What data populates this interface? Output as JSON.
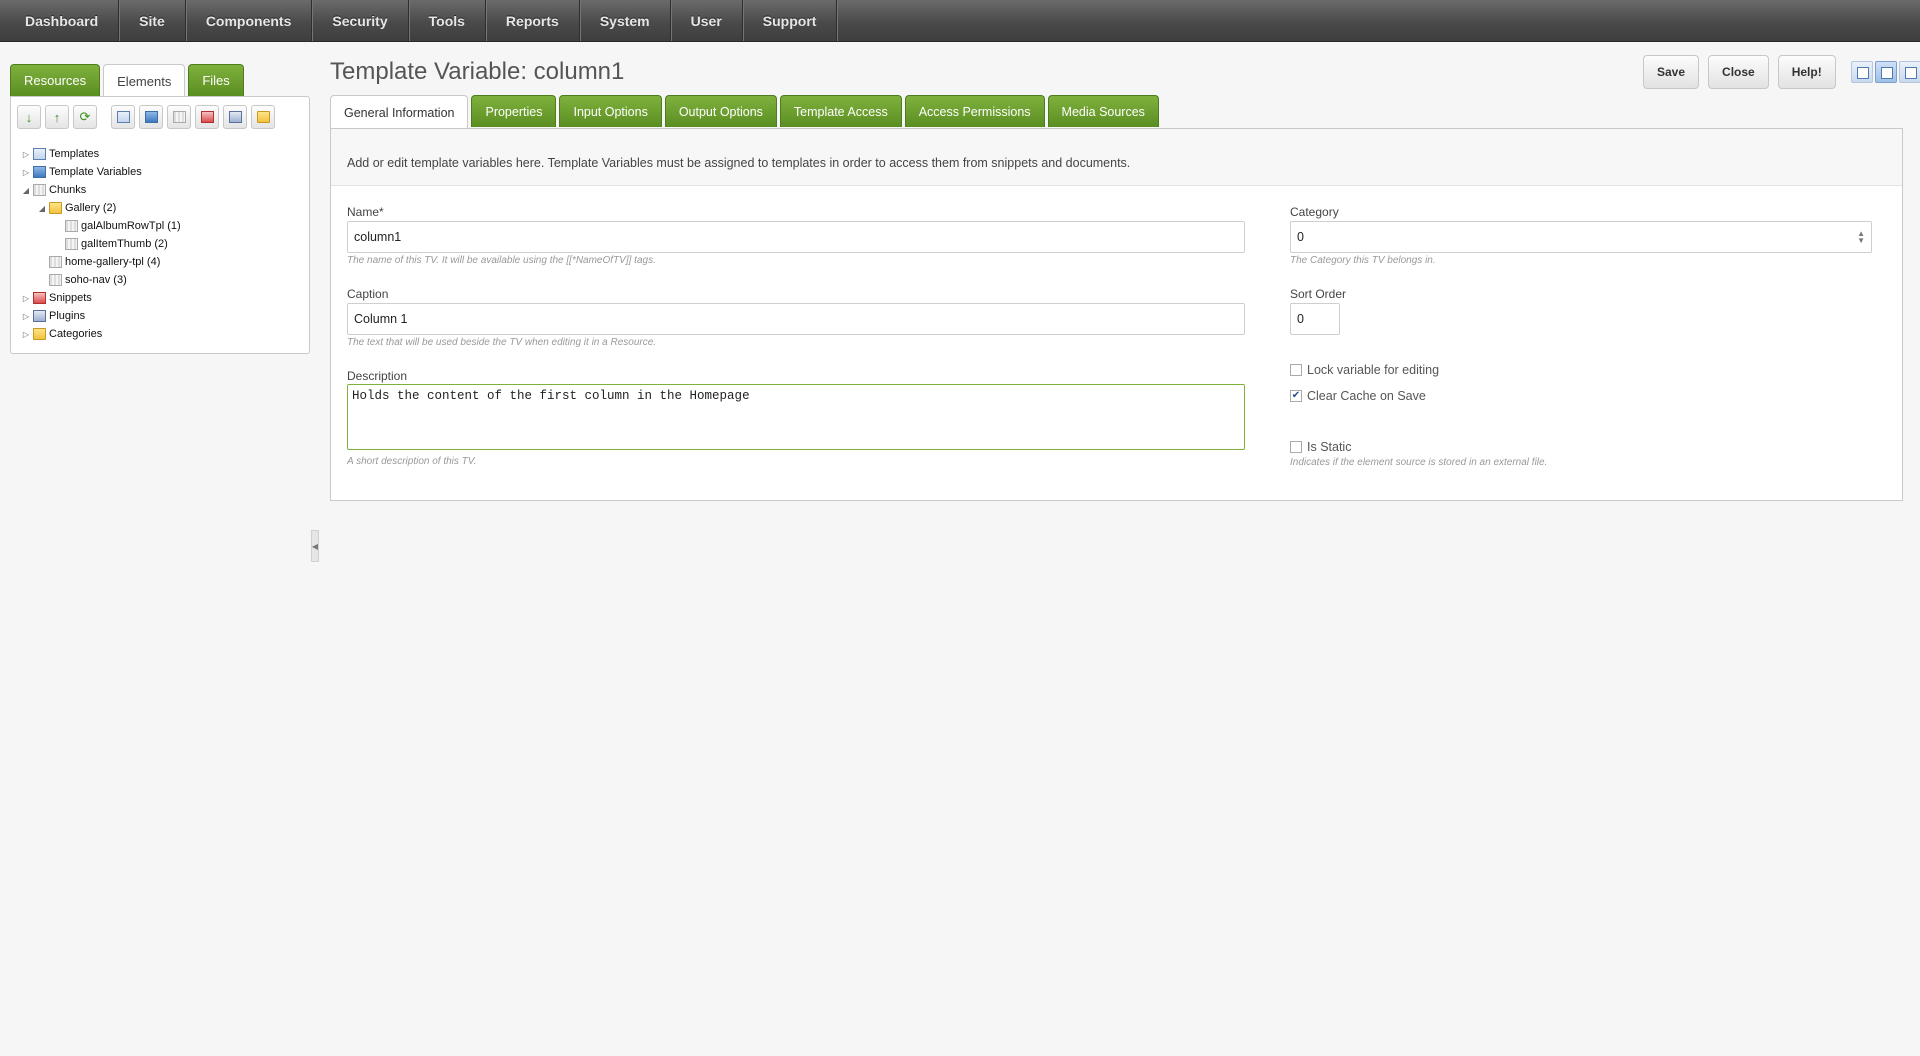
{
  "topnav": {
    "items": [
      "Dashboard",
      "Site",
      "Components",
      "Security",
      "Tools",
      "Reports",
      "System",
      "User",
      "Support"
    ]
  },
  "left": {
    "tabs": [
      "Resources",
      "Elements",
      "Files"
    ],
    "active_tab": "Elements",
    "toolbar_icons": [
      "sort-down-icon",
      "sort-up-icon",
      "refresh-icon",
      "new-template-icon",
      "new-tv-icon",
      "new-chunk-icon",
      "new-snippet-icon",
      "new-plugin-icon",
      "new-category-icon"
    ],
    "tree": [
      {
        "label": "Templates",
        "level": 0,
        "arrow": "right",
        "icon": "template-icon"
      },
      {
        "label": "Template Variables",
        "level": 0,
        "arrow": "right",
        "icon": "tv-icon"
      },
      {
        "label": "Chunks",
        "level": 0,
        "arrow": "down",
        "icon": "chunk-icon"
      },
      {
        "label": "Gallery (2)",
        "level": 1,
        "arrow": "down",
        "icon": "folder-icon"
      },
      {
        "label": "galAlbumRowTpl (1)",
        "level": 2,
        "arrow": "",
        "icon": "chunk-icon"
      },
      {
        "label": "galItemThumb (2)",
        "level": 2,
        "arrow": "",
        "icon": "chunk-icon"
      },
      {
        "label": "home-gallery-tpl (4)",
        "level": 1,
        "arrow": "",
        "icon": "chunk-icon"
      },
      {
        "label": "soho-nav (3)",
        "level": 1,
        "arrow": "",
        "icon": "chunk-icon"
      },
      {
        "label": "Snippets",
        "level": 0,
        "arrow": "right",
        "icon": "snippet-icon"
      },
      {
        "label": "Plugins",
        "level": 0,
        "arrow": "right",
        "icon": "plugin-icon"
      },
      {
        "label": "Categories",
        "level": 0,
        "arrow": "right",
        "icon": "folder-icon"
      }
    ]
  },
  "main": {
    "title": "Template Variable: column1",
    "buttons": {
      "save": "Save",
      "close": "Close",
      "help": "Help!"
    },
    "tabs": [
      "General Information",
      "Properties",
      "Input Options",
      "Output Options",
      "Template Access",
      "Access Permissions",
      "Media Sources"
    ],
    "active_tab": "General Information",
    "intro": "Add or edit template variables here. Template Variables must be assigned to templates in order to access them from snippets and documents.",
    "name": {
      "label": "Name*",
      "value": "column1",
      "hint": "The name of this TV. It will be available using the [[*NameOfTV]] tags."
    },
    "caption": {
      "label": "Caption",
      "value": "Column 1",
      "hint": "The text that will be used beside the TV when editing it in a Resource."
    },
    "description": {
      "label": "Description",
      "value": "Holds the content of the first column in the Homepage",
      "hint": "A short description of this TV."
    },
    "category": {
      "label": "Category",
      "value": "0",
      "hint": "The Category this TV belongs in."
    },
    "sort_order": {
      "label": "Sort Order",
      "value": "0"
    },
    "lock": {
      "label": "Lock variable for editing",
      "checked": false
    },
    "clear_cache": {
      "label": "Clear Cache on Save",
      "checked": true
    },
    "is_static": {
      "label": "Is Static",
      "checked": false,
      "hint": "Indicates if the element source is stored in an external file."
    }
  }
}
